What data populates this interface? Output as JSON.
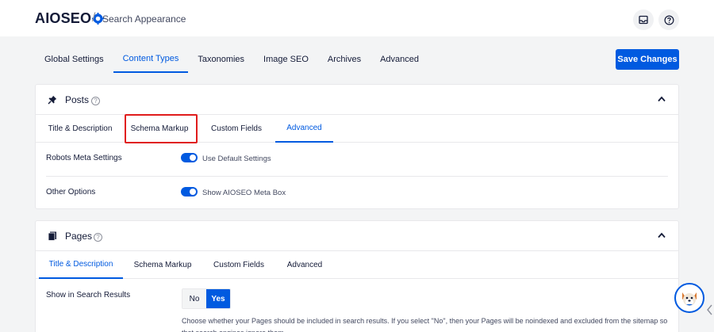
{
  "app": {
    "logo_text": "AIOSEO",
    "breadcrumb_separator": "/",
    "page_title": "Search Appearance"
  },
  "main_tabs": [
    {
      "label": "Global Settings",
      "active": false
    },
    {
      "label": "Content Types",
      "active": true
    },
    {
      "label": "Taxonomies",
      "active": false
    },
    {
      "label": "Image SEO",
      "active": false
    },
    {
      "label": "Archives",
      "active": false
    },
    {
      "label": "Advanced",
      "active": false
    }
  ],
  "save_button": "Save Changes",
  "posts_card": {
    "title": "Posts",
    "help": "?",
    "sub_tabs": [
      {
        "label": "Title & Description",
        "active": false
      },
      {
        "label": "Schema Markup",
        "active": false,
        "highlighted": true
      },
      {
        "label": "Custom Fields",
        "active": false
      },
      {
        "label": "Advanced",
        "active": true
      }
    ],
    "rows": [
      {
        "label": "Robots Meta Settings",
        "toggle_label": "Use Default Settings",
        "on": true
      },
      {
        "label": "Other Options",
        "toggle_label": "Show AIOSEO Meta Box",
        "on": true
      }
    ]
  },
  "pages_card": {
    "title": "Pages",
    "help": "?",
    "sub_tabs": [
      {
        "label": "Title & Description",
        "active": true
      },
      {
        "label": "Schema Markup",
        "active": false
      },
      {
        "label": "Custom Fields",
        "active": false
      },
      {
        "label": "Advanced",
        "active": false
      }
    ],
    "show_in_search": {
      "label": "Show in Search Results",
      "no": "No",
      "yes": "Yes",
      "selected": "Yes",
      "description": "Choose whether your Pages should be included in search results. If you select \"No\", then your Pages will be noindexed and excluded from the sitemap so that search engines ignore them."
    }
  },
  "colors": {
    "accent": "#005ae0",
    "highlight": "#e01c1c",
    "text": "#141b38",
    "background": "#f3f4f5"
  },
  "icons": {
    "header_inbox": "inbox-icon",
    "header_help": "help-icon",
    "posts": "pushpin-icon",
    "pages": "pages-icon",
    "collapse": "chevron-up-icon"
  }
}
